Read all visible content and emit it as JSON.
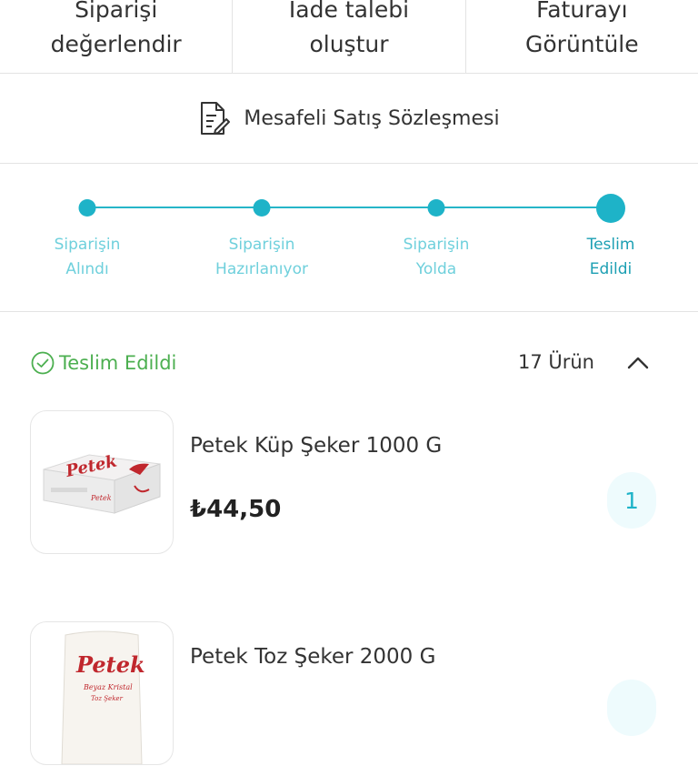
{
  "actions": [
    {
      "label": "Siparişi\ndeğerlendir"
    },
    {
      "label": "İade talebi\noluştur"
    },
    {
      "label": "Faturayı\nGörüntüle"
    }
  ],
  "contract": {
    "label": "Mesafeli Satış Sözleşmesi",
    "icon": "document-edit-icon"
  },
  "tracker": {
    "steps": [
      {
        "label": "Siparişin\nAlındı"
      },
      {
        "label": "Siparişin\nHazırlanıyor"
      },
      {
        "label": "Siparişin\nYolda"
      },
      {
        "label": "Teslim\nEdildi"
      }
    ],
    "current_step": 4,
    "accent_color": "#1eb3c8"
  },
  "order": {
    "status": "Teslim Edildi",
    "status_color": "#4caf50",
    "item_count": "17 Ürün"
  },
  "products": [
    {
      "name": "Petek Küp Şeker 1000 G",
      "price": "₺44,50",
      "quantity": "1",
      "brand_text": "Petek"
    },
    {
      "name": "Petek Toz Şeker 2000 G",
      "price": "",
      "quantity": "",
      "brand_text": "Petek"
    }
  ]
}
